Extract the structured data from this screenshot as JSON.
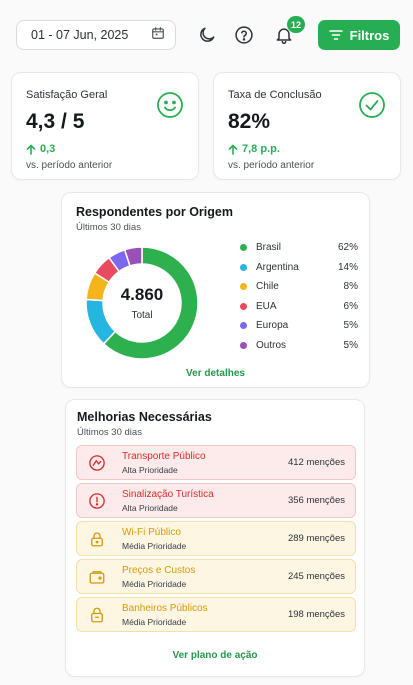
{
  "header": {
    "date_range": "01 - 07 Jun, 2025",
    "notification_count": "12",
    "filter_label": "Filtros"
  },
  "kpis": [
    {
      "title": "Satisfação Geral",
      "value": "4,3 / 5",
      "delta": "0,3",
      "note": "vs. período anterior",
      "icon": "smile-icon"
    },
    {
      "title": "Taxa de Conclusão",
      "value": "82%",
      "delta": "7,8 p.p.",
      "note": "vs. período anterior",
      "icon": "check-circle-icon"
    }
  ],
  "respondentes": {
    "title": "Respondentes por Origem",
    "subtitle": "Últimos 30 dias",
    "total_value": "4.860",
    "total_label": "Total",
    "link": "Ver detalhes",
    "legend": [
      {
        "name": "Brasil",
        "pct": "62%",
        "color": "#2eb04f"
      },
      {
        "name": "Argentina",
        "pct": "14%",
        "color": "#26b5e0"
      },
      {
        "name": "Chile",
        "pct": "8%",
        "color": "#f5b41a"
      },
      {
        "name": "EUA",
        "pct": "6%",
        "color": "#e84a5f"
      },
      {
        "name": "Europa",
        "pct": "5%",
        "color": "#7b68ee"
      },
      {
        "name": "Outros",
        "pct": "5%",
        "color": "#9b4fb8"
      }
    ]
  },
  "chart_data": {
    "type": "pie",
    "categories": [
      "Brasil",
      "Argentina",
      "Chile",
      "EUA",
      "Europa",
      "Outros"
    ],
    "values": [
      62,
      14,
      8,
      6,
      5,
      5
    ],
    "title": "Respondentes por Origem",
    "subtitle": "Últimos 30 dias",
    "center_value": "4.860",
    "center_label": "Total",
    "legend_position": "right"
  },
  "melhorias": {
    "title": "Melhorias Necessárias",
    "subtitle": "Últimos 30 dias",
    "link": "Ver plano de ação",
    "items": [
      {
        "name": "Transporte Público",
        "priority": "Alta Prioridade",
        "count": "412 menções",
        "level": "red",
        "icon": "bus-icon"
      },
      {
        "name": "Sinalização Turística",
        "priority": "Alta Prioridade",
        "count": "356 menções",
        "level": "red",
        "icon": "alert-circle-icon"
      },
      {
        "name": "Wi-Fi Público",
        "priority": "Média Prioridade",
        "count": "289 menções",
        "level": "yel",
        "icon": "wifi-lock-icon"
      },
      {
        "name": "Preços e Custos",
        "priority": "Média Prioridade",
        "count": "245 menções",
        "level": "yel",
        "icon": "wallet-icon"
      },
      {
        "name": "Banheiros Públicos",
        "priority": "Média Prioridade",
        "count": "198 menções",
        "level": "yel",
        "icon": "restroom-icon"
      }
    ]
  },
  "colors": {
    "accent": "#27ae52",
    "high_priority": "#d92d2d",
    "medium_priority": "#d69a09"
  }
}
